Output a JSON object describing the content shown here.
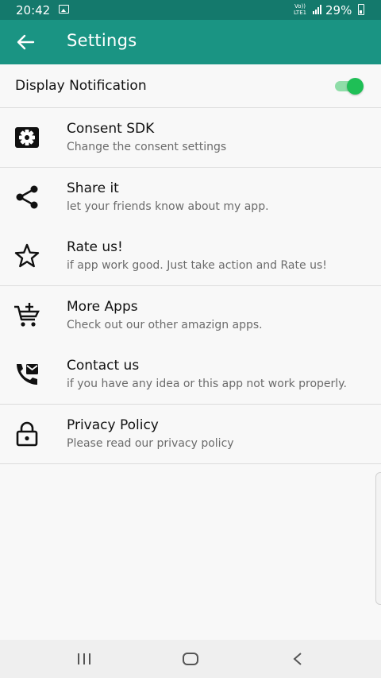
{
  "status_bar": {
    "time": "20:42",
    "network_top": "Vo))",
    "network_bottom": "LTE1",
    "battery": "29%"
  },
  "app_bar": {
    "title": "Settings"
  },
  "notification_row": {
    "label": "Display Notification",
    "toggle_on": true
  },
  "items": [
    {
      "icon": "gear-icon",
      "title": "Consent SDK",
      "subtitle": "Change the consent settings"
    },
    {
      "icon": "share-icon",
      "title": "Share it",
      "subtitle": "let your friends know about my app."
    },
    {
      "icon": "star-icon",
      "title": "Rate us!",
      "subtitle": "if app work good. Just take action and Rate us!"
    },
    {
      "icon": "cart-plus-icon",
      "title": "More Apps",
      "subtitle": "Check out our other amazign apps."
    },
    {
      "icon": "contact-phone-icon",
      "title": "Contact us",
      "subtitle": "if you have any idea or this app not work properly."
    },
    {
      "icon": "lock-icon",
      "title": "Privacy Policy",
      "subtitle": "Please read our privacy policy"
    }
  ],
  "colors": {
    "status_bar": "#14796c",
    "app_bar": "#1a9483",
    "toggle": "#1fbf56"
  }
}
